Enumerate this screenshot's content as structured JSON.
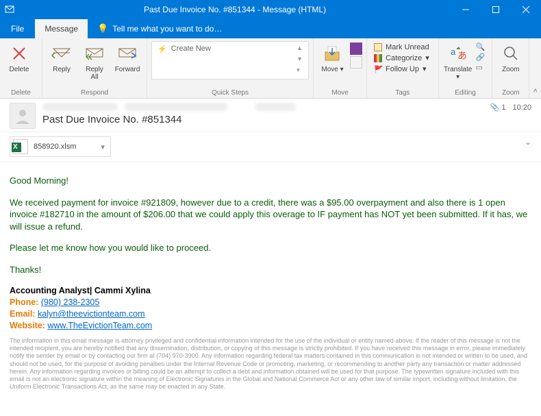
{
  "window": {
    "title": "Past Due Invoice No. #851344 - Message (HTML)"
  },
  "menu": {
    "file": "File",
    "message": "Message",
    "tell_me": "Tell me what you want to do…"
  },
  "ribbon": {
    "delete": {
      "delete": "Delete",
      "group": "Delete"
    },
    "respond": {
      "reply": "Reply",
      "reply_all": "Reply\nAll",
      "forward": "Forward",
      "group": "Respond"
    },
    "quicksteps": {
      "create": "Create New",
      "group": "Quick Steps"
    },
    "move": {
      "move": "Move",
      "group": "Move"
    },
    "tags": {
      "unread": "Mark Unread",
      "categorize": "Categorize",
      "followup": "Follow Up",
      "group": "Tags"
    },
    "translate": {
      "label": "Translate",
      "group": "Editing"
    },
    "zoom": {
      "label": "Zoom",
      "group": "Zoom"
    }
  },
  "header": {
    "subject": "Past Due Invoice No. #851344",
    "attach_count": "1",
    "time": "10:20"
  },
  "attachment": {
    "filename": "858920.xlsm"
  },
  "body": {
    "greeting": "Good Morning!",
    "p1": "We received payment for invoice #921809, however due to a credit, there was a $95.00 overpayment and also there is 1 open invoice #182710 in the amount of $206.00 that we could apply this overage to IF payment has NOT yet been submitted. If it has, we will issue a refund.",
    "p2": "Please let me know how you would like to proceed.",
    "p3": "Thanks!"
  },
  "signature": {
    "title": "Accounting Analyst| Cammi Xylina",
    "phone_label": "Phone:",
    "phone": "(980) 238-2305",
    "email_label": "Email:",
    "email": "kalyn@theevictionteam.com",
    "website_label": "Website:",
    "website": "www.TheEvictionTeam.com"
  },
  "disclaimer": "The information in this email message is attorney privileged and confidential information intended for the use of the individual or entity named above. If the reader of this message is not the intended recipient, you are hereby notified that any dissemination, distribution, or copying of this message is strictly prohibited. If you have received this message in error, please immediately notify the sender by email or by contacting our firm at (704) 970-3900. Any information regarding federal tax matters contained in this communication is not intended or written to be used, and should not be used, for the purpose of avoiding penalties under the Internal Revenue Code or promoting, marketing, or recommending to another party any transaction or matter addressed herein. Any information regarding invoices or billing could be an attempt to collect a debt and information obtained will be used for that purpose. The typewritten signature included with this email is not an electronic signature within the meaning of Electronic Signatures in the Global and National Commerce Act or any other law of similar import, including without limitation, the Uniform Electronic Transactions Act, as the same may be enacted in any State."
}
